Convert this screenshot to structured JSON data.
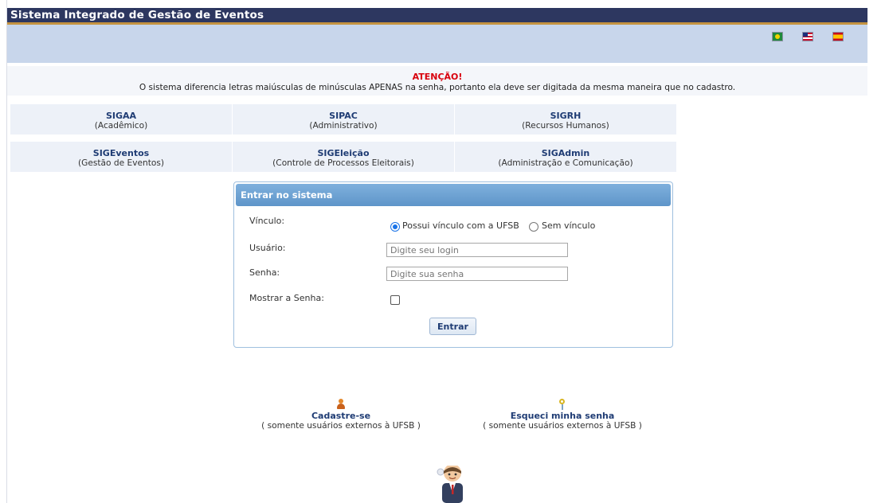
{
  "header": {
    "title": "Sistema Integrado de Gestão de Eventos"
  },
  "languages": [
    "brazil-flag-icon",
    "usa-flag-icon",
    "spain-flag-icon"
  ],
  "warning": {
    "title": "ATENÇÃO!",
    "text": "O sistema diferencia letras maiúsculas de minúsculas APENAS na senha, portanto ela deve ser digitada da mesma maneira que no cadastro."
  },
  "systems": [
    {
      "name": "SIGAA",
      "desc": "(Acadêmico)"
    },
    {
      "name": "SIPAC",
      "desc": "(Administrativo)"
    },
    {
      "name": "SIGRH",
      "desc": "(Recursos Humanos)"
    },
    {
      "name": "SIGEventos",
      "desc": "(Gestão de Eventos)"
    },
    {
      "name": "SIGEleição",
      "desc": "(Controle de Processos Eleitorais)"
    },
    {
      "name": "SIGAdmin",
      "desc": "(Administração e Comunicação)"
    }
  ],
  "login": {
    "title": "Entrar no sistema",
    "vinculo_label": "Vínculo:",
    "option_with": "Possui vínculo com a UFSB",
    "option_without": "Sem vínculo",
    "user_label": "Usuário:",
    "user_placeholder": "Digite seu login",
    "password_label": "Senha:",
    "password_placeholder": "Digite sua senha",
    "show_password_label": "Mostrar a Senha:",
    "submit_label": "Entrar"
  },
  "links": {
    "register_title": "Cadastre-se",
    "register_sub": "( somente usuários externos à UFSB )",
    "forgot_title": "Esqueci minha senha",
    "forgot_sub": "( somente usuários externos à UFSB )"
  },
  "colors": {
    "header_bg": "#2d3760",
    "header_rule": "#c59340",
    "band_bg": "#c8d6eb",
    "warning_title": "#d8000c",
    "link_text": "#1f3c74",
    "login_header": "#6aa0d2"
  }
}
